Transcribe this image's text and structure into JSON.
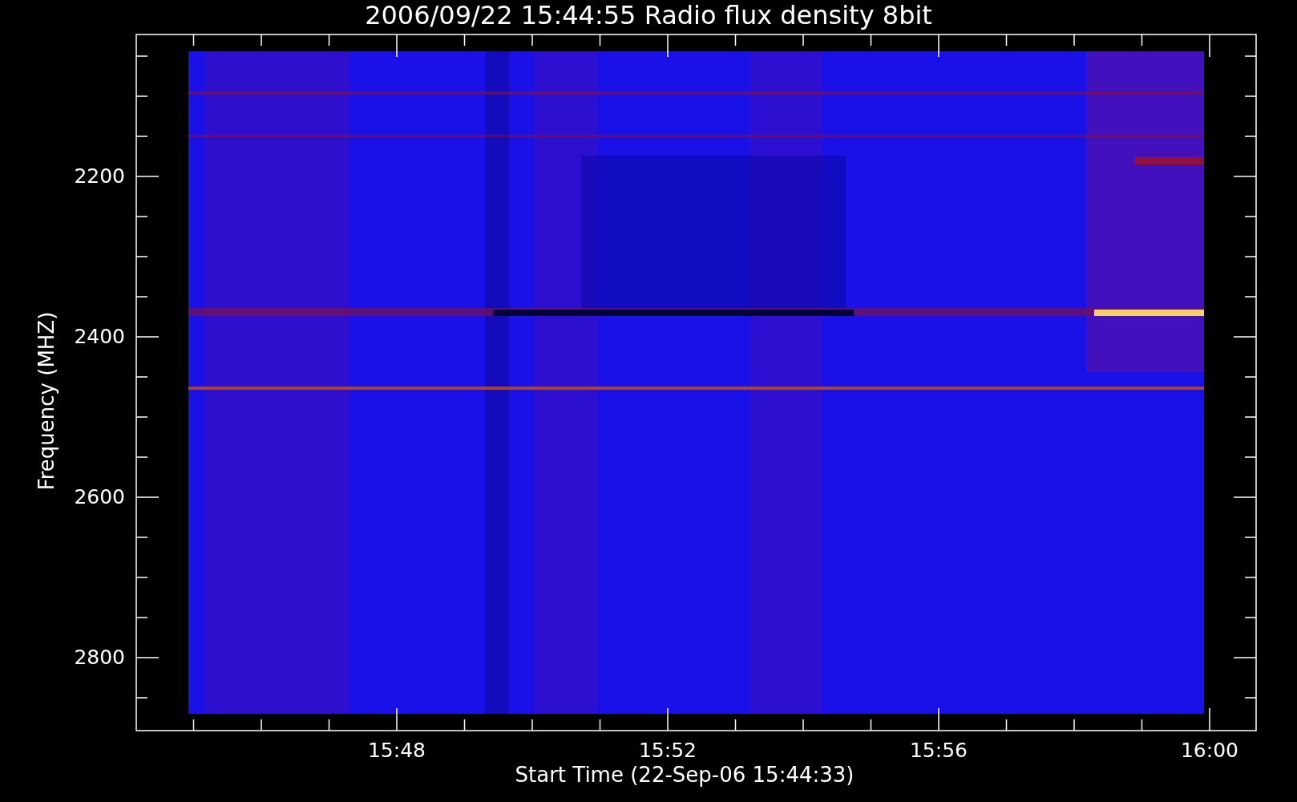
{
  "title": "2006/09/22 15:44:55 Radio flux density 8bit",
  "y_axis": {
    "label": "Frequency (MHZ)",
    "ticks": [
      "2200",
      "2400",
      "2600",
      "2800"
    ]
  },
  "x_axis": {
    "label": "Start Time (22-Sep-06 15:44:33)",
    "ticks": [
      "15:48",
      "15:52",
      "15:56",
      "16:00"
    ]
  }
}
